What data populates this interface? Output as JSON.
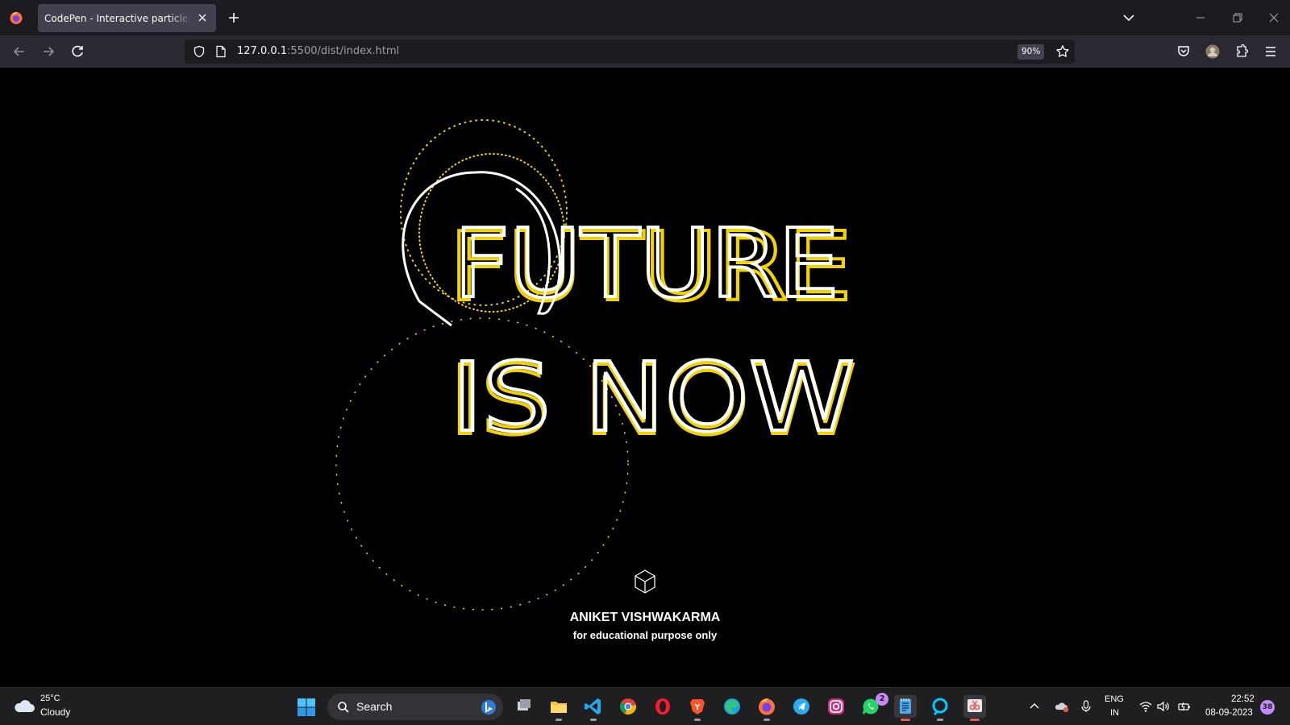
{
  "browser": {
    "tab_title": "CodePen - Interactive particles text",
    "url_host": "127.0.0.1",
    "url_path": ":5500/dist/index.html",
    "zoom": "90%"
  },
  "page": {
    "headline_line1": "FUTURE",
    "headline_line2": "IS NOW",
    "author": "ANIKET VISHWAKARMA",
    "disclaimer": "for educational purpose only",
    "accent_color": "#f2d300",
    "text_color": "#ffffff",
    "background": "#000000"
  },
  "taskbar": {
    "weather_temp": "25°C",
    "weather_condition": "Cloudy",
    "search_label": "Search",
    "whatsapp_badge": "2",
    "apps": [
      "file-explorer",
      "task-view",
      "vs-code",
      "chrome",
      "opera",
      "brave",
      "edge",
      "firefox",
      "telegram",
      "instagram",
      "whatsapp",
      "notepad",
      "alexa",
      "snipping-tool"
    ],
    "lang_line1": "ENG",
    "lang_line2": "IN",
    "time": "22:52",
    "date": "08-09-2023",
    "notification_count": "38"
  }
}
